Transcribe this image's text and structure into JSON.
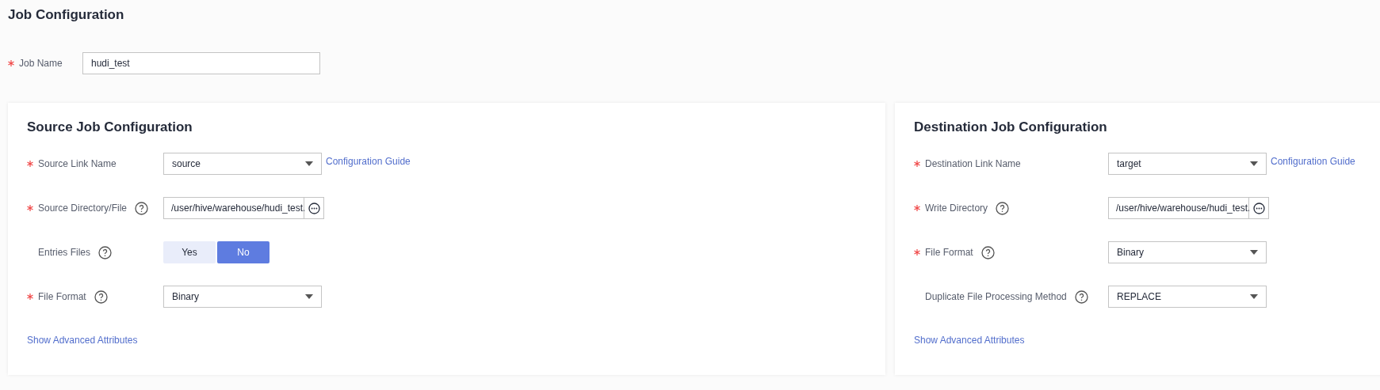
{
  "title": "Job Configuration",
  "job_name": {
    "label": "Job Name",
    "required": true,
    "value": "hudi_test"
  },
  "panels": [
    {
      "title": "Source Job Configuration",
      "fields": [
        {
          "kind": "select",
          "label": "Source Link Name",
          "required": true,
          "help": false,
          "value": "source",
          "link": "Configuration Guide"
        },
        {
          "kind": "path",
          "label": "Source Directory/File",
          "required": true,
          "help": true,
          "value": "/user/hive/warehouse/hudi_test."
        },
        {
          "kind": "toggle",
          "label": "Entries Files",
          "required": false,
          "help": true,
          "options": [
            {
              "label": "Yes",
              "selected": false
            },
            {
              "label": "No",
              "selected": true
            }
          ]
        },
        {
          "kind": "select",
          "label": "File Format",
          "required": true,
          "help": true,
          "value": "Binary"
        }
      ],
      "advanced_link": "Show Advanced Attributes"
    },
    {
      "title": "Destination Job Configuration",
      "fields": [
        {
          "kind": "select",
          "label": "Destination Link Name",
          "required": true,
          "help": false,
          "value": "target",
          "link": "Configuration Guide"
        },
        {
          "kind": "path",
          "label": "Write Directory",
          "required": true,
          "help": true,
          "value": "/user/hive/warehouse/hudi_test."
        },
        {
          "kind": "select",
          "label": "File Format",
          "required": true,
          "help": true,
          "value": "Binary"
        },
        {
          "kind": "select",
          "label": "Duplicate File Processing Method",
          "required": false,
          "help": true,
          "value": "REPLACE"
        }
      ],
      "advanced_link": "Show Advanced Attributes"
    }
  ]
}
